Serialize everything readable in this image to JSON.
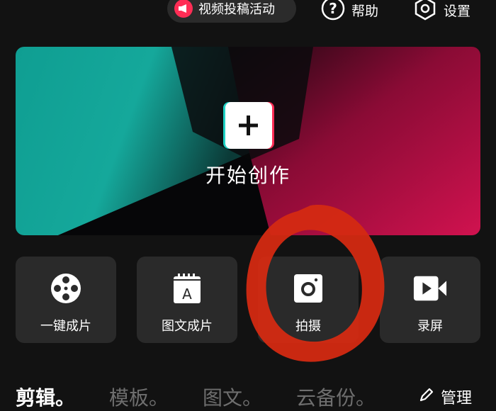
{
  "topbar": {
    "campaign_label": "视频投稿活动",
    "help_label": "帮助",
    "settings_label": "设置"
  },
  "hero": {
    "title": "开始创作",
    "colors": {
      "teal": "#14a79b",
      "magenta": "#c2104a",
      "dark": "#0b0b0d"
    }
  },
  "tools": [
    {
      "label": "一键成片",
      "icon": "film-reel-icon"
    },
    {
      "label": "图文成片",
      "icon": "text-document-icon"
    },
    {
      "label": "拍摄",
      "icon": "camera-icon"
    },
    {
      "label": "录屏",
      "icon": "video-record-icon"
    }
  ],
  "tabs": [
    {
      "label": "剪辑",
      "active": true
    },
    {
      "label": "模板",
      "active": false
    },
    {
      "label": "图文",
      "active": false
    },
    {
      "label": "云备份",
      "active": false
    }
  ],
  "manage_label": "管理",
  "annotation_color": "#d42a12"
}
